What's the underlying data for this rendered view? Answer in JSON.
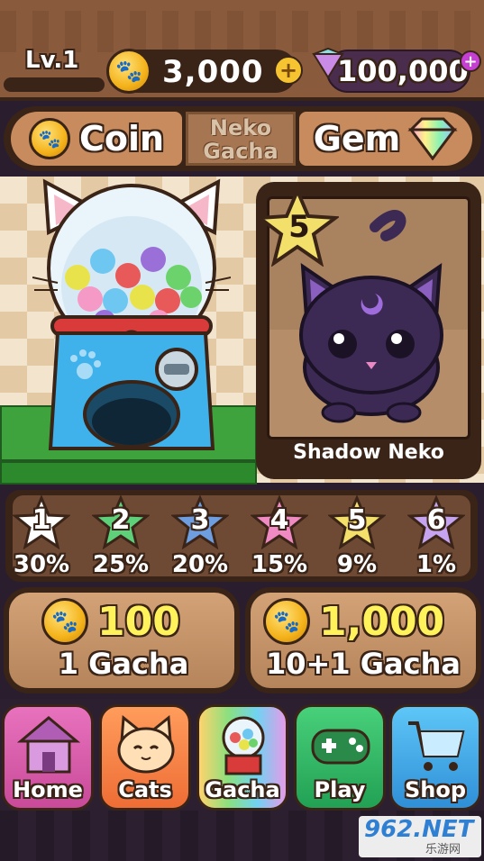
{
  "header": {
    "level": "Lv.1",
    "coins": "3,000",
    "gems": "100,000",
    "coin_plus": "+",
    "gem_plus": "+"
  },
  "tabs": {
    "coin": "Coin",
    "neko_line1": "Neko",
    "neko_line2": "Gacha",
    "gem": "Gem"
  },
  "result": {
    "name": "Shadow Neko",
    "stars": "5"
  },
  "rarities": [
    {
      "num": "1",
      "pct": "30%",
      "color": "#ffffff"
    },
    {
      "num": "2",
      "pct": "25%",
      "color": "#5fd07a"
    },
    {
      "num": "3",
      "pct": "20%",
      "color": "#6f9ee0"
    },
    {
      "num": "4",
      "pct": "15%",
      "color": "#f08ac2"
    },
    {
      "num": "5",
      "pct": "9%",
      "color": "#f3e06a"
    },
    {
      "num": "6",
      "pct": "1%",
      "color": "#c6a4ef"
    }
  ],
  "gacha": {
    "single_price": "100",
    "single_label": "1 Gacha",
    "multi_price": "1,000",
    "multi_label": "10+1 Gacha"
  },
  "nav": {
    "home": "Home",
    "cats": "Cats",
    "gacha": "Gacha",
    "play": "Play",
    "shop": "Shop"
  },
  "watermark": {
    "main": "962.NET",
    "sub": "乐游网"
  },
  "colors": {
    "outline": "#3a2418",
    "coin": "#f4b21a",
    "price_text": "#fff25a"
  }
}
